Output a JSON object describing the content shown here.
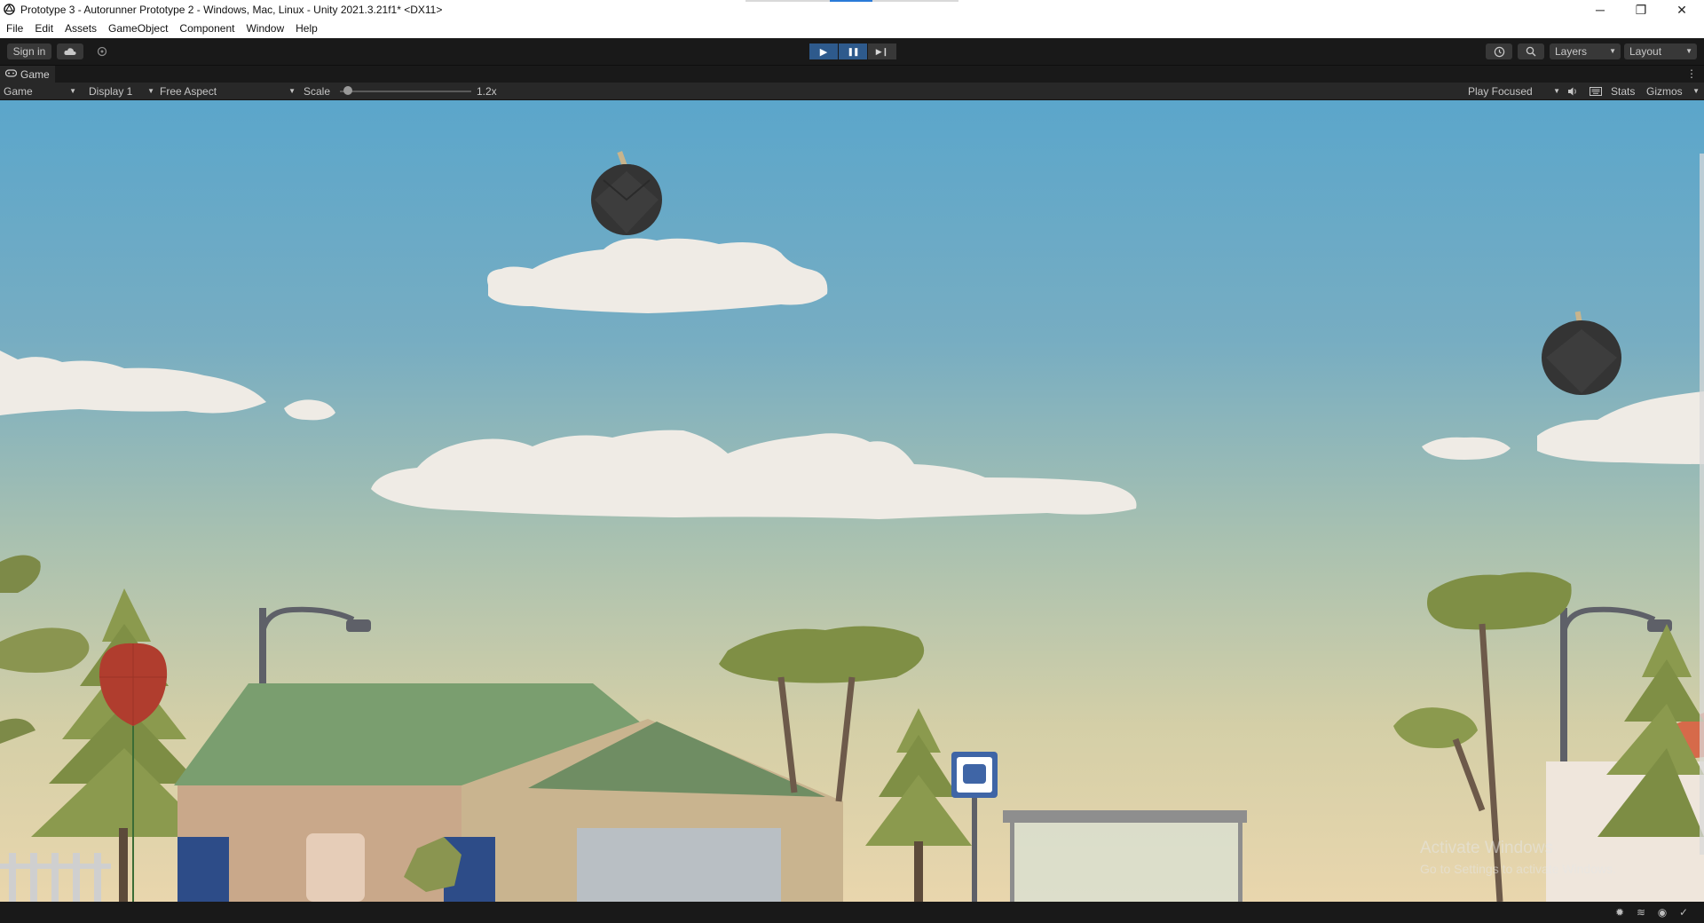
{
  "window": {
    "title": "Prototype 3 - Autorunner Prototype 2 - Windows, Mac, Linux - Unity 2021.3.21f1* <DX11>",
    "controls": {
      "minimize": "─",
      "restore": "❐",
      "close": "✕"
    }
  },
  "menu": [
    "File",
    "Edit",
    "Assets",
    "GameObject",
    "Component",
    "Window",
    "Help"
  ],
  "toolbar": {
    "sign_in": "Sign in",
    "cloud_icon": "cloud-icon",
    "collab_icon": "collab-icon",
    "play_icon": "▶",
    "pause_icon": "❚❚",
    "step_icon": "▶❙",
    "layers_label": "Layers",
    "layout_label": "Layout"
  },
  "tab": {
    "label": "Game"
  },
  "game_bar": {
    "view": "Game",
    "display": "Display 1",
    "aspect": "Free Aspect",
    "scale_label": "Scale",
    "scale_value": "1.2x",
    "scale_fraction": 0.06,
    "play_mode": "Play Focused",
    "stats": "Stats",
    "gizmos": "Gizmos"
  },
  "watermark": {
    "line1": "Activate Windows",
    "line2": "Go to Settings to activate Windows."
  },
  "colors": {
    "sky_top": "#5ba6cb",
    "sky_bottom": "#e9d6ad",
    "play_active": "#2e5a8c",
    "editor_bg": "#191919",
    "panel_bg": "#282828"
  }
}
